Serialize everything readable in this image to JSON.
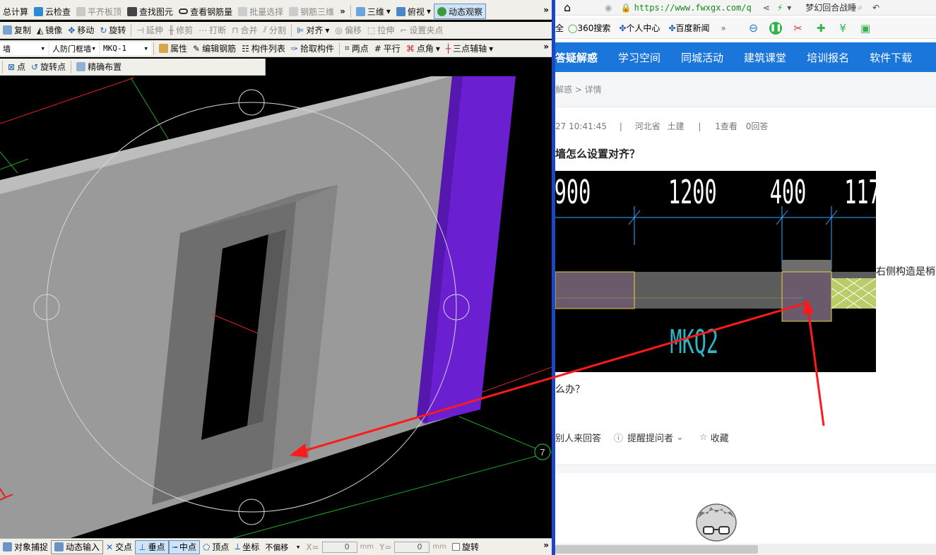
{
  "cad": {
    "toolbar1": {
      "items": [
        "总计算",
        "云检查",
        "平齐板顶",
        "查找图元",
        "查看钢筋量",
        "批量选择",
        "钢筋三维"
      ],
      "view3d": "三维",
      "top_view": "俯视",
      "dynamic_view": "动态观察"
    },
    "toolbar2": {
      "items": [
        "复制",
        "镜像",
        "移动",
        "旋转",
        "延伸",
        "修剪",
        "打断",
        "合并",
        "分割"
      ],
      "align": "对齐",
      "items2": [
        "偏移",
        "拉伸",
        "设置夹点"
      ]
    },
    "toolbar3": {
      "component_type": "墙",
      "component_subtype": "人防门框墙",
      "component_name": "MKQ-1",
      "items": [
        "属性",
        "编辑钢筋",
        "构件列表",
        "拾取构件",
        "两点",
        "平行",
        "点角"
      ],
      "three_point_aux": "三点辅轴"
    },
    "toolbar4": {
      "items": [
        "点",
        "旋转点",
        "精确布置"
      ]
    },
    "viewport": {
      "axis_label": "7"
    },
    "status": {
      "snap": "对象捕捉",
      "dynamic_input": "动态输入",
      "intersection": "交点",
      "perpendicular": "垂点",
      "midpoint": "中点",
      "vertex": "顶点",
      "coordinate": "坐标",
      "offset_mode": "不偏移",
      "x_label": "X=",
      "x_value": "0",
      "y_label": "Y=",
      "y_value": "0",
      "unit": "mm",
      "rotate": "旋转"
    }
  },
  "browser": {
    "url": "https://www.fwxgx.com/q",
    "search_hint": "梦幻回合战睡",
    "bookmarks": [
      "全",
      "360搜索",
      "个人中心",
      "百度新闻"
    ],
    "nav_items": [
      "答疑解惑",
      "学习空间",
      "同城活动",
      "建筑课堂",
      "培训报名",
      "软件下载"
    ],
    "breadcrumb": "解惑 > 详情",
    "meta": {
      "time": "27 10:41:45",
      "location": "河北省",
      "category": "土建",
      "views": "1查看",
      "answers": "0回答"
    },
    "question_title": "墙怎么设置对齐？",
    "drawing": {
      "dims": [
        "900",
        "1200",
        "400",
        "117"
      ],
      "label": "MKQ2"
    },
    "side_text": "右侧构造是梢",
    "question_tail": "么办？",
    "actions": {
      "invite": "别人来回答",
      "remind": "提醒提问者",
      "favorite": "收藏"
    }
  },
  "colors": {
    "nav_blue": "#1b76dc",
    "divider_blue": "#1a47c6",
    "arrow_red": "#ff1a1a",
    "purple_column": "#6a1fd0"
  }
}
